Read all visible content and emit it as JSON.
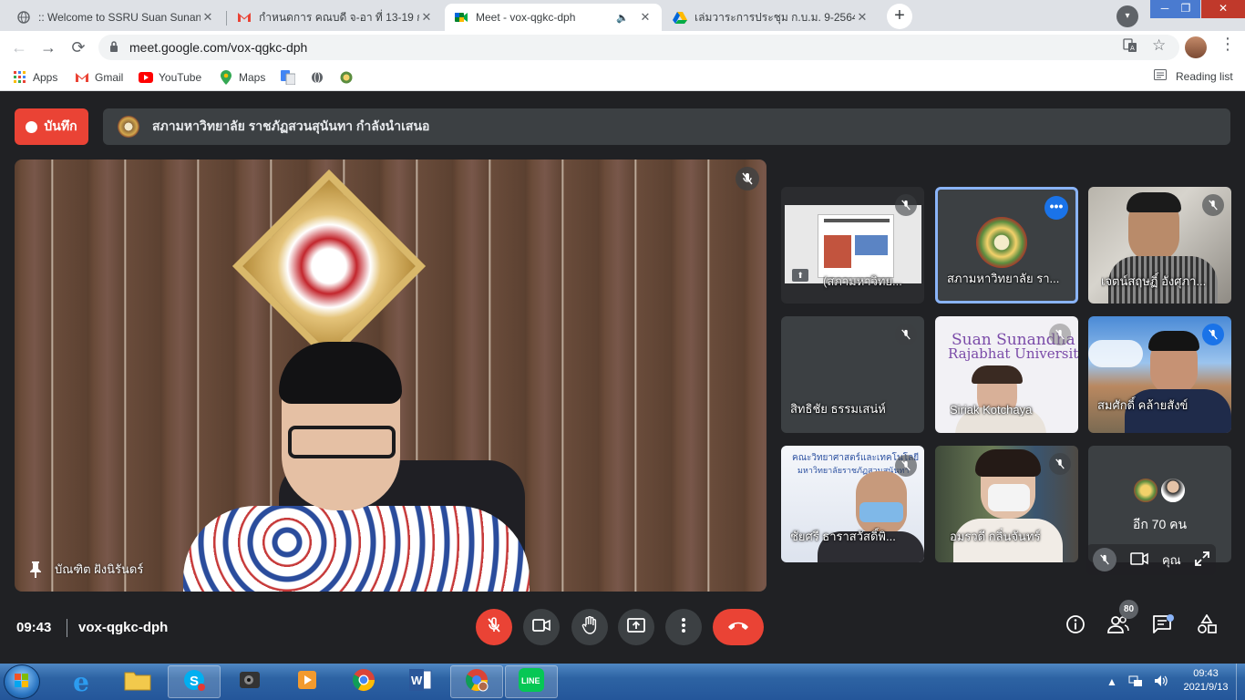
{
  "browser": {
    "tabs": [
      {
        "title": ":: Welcome to SSRU Suan Sunandha",
        "active": false
      },
      {
        "title": "กำหนดการ คณบดี จ-อา ที่ 13-19 ก.ย.",
        "active": false
      },
      {
        "title": "Meet - vox-qgkc-dph",
        "active": true
      },
      {
        "title": "เล่มวาระการประชุม ก.บ.ม. 9-2564.pdf",
        "active": false
      }
    ],
    "url": "meet.google.com/vox-qgkc-dph",
    "bookmarks": [
      "Apps",
      "Gmail",
      "YouTube",
      "Maps"
    ],
    "reading_list": "Reading list"
  },
  "meet": {
    "record_label": "บันทึก",
    "presenting_text": "สภามหาวิทยาลัย ราชภัฏสวนสุนันทา กำลังนำเสนอ",
    "main_speaker": "บัณฑิต ฝังนิรันดร์",
    "tiles": [
      {
        "name": "(สภามหาวิทย..."
      },
      {
        "name": "สภามหาวิทยาลัย รา..."
      },
      {
        "name": "เจตน์สฤษฏิ์ อังศุภา..."
      },
      {
        "name": "สิทธิชัย ธรรมเสน่ห์"
      },
      {
        "name": "Siriak Kotchaya"
      },
      {
        "name": "สมศักดิ์ คล้ายสังข์"
      },
      {
        "name": "ชัยศรี ธาราสวัสดิ์พิ..."
      },
      {
        "name": "อมรวดี กลิ่นจันทร์"
      }
    ],
    "tile_text": {
      "suan_line1": "Suan Sunandha",
      "suan_line2": "Rajabhat University",
      "faculty_line1": "คณะวิทยาศาสตร์และเทคโนโลยี",
      "faculty_line2": "มหาวิทยาลัยราชภัฏสวนสุนันทา"
    },
    "others_label": "อีก 70 คน",
    "self_label": "คุณ",
    "time": "09:43",
    "meeting_code": "vox-qgkc-dph",
    "participants_badge": "80"
  },
  "taskbar": {
    "time": "09:43",
    "date": "2021/9/13"
  },
  "colors": {
    "meet_bg": "#202124",
    "tile_bg": "#3c4043",
    "danger": "#ea4335",
    "selected_outline": "#8ab4f8"
  }
}
